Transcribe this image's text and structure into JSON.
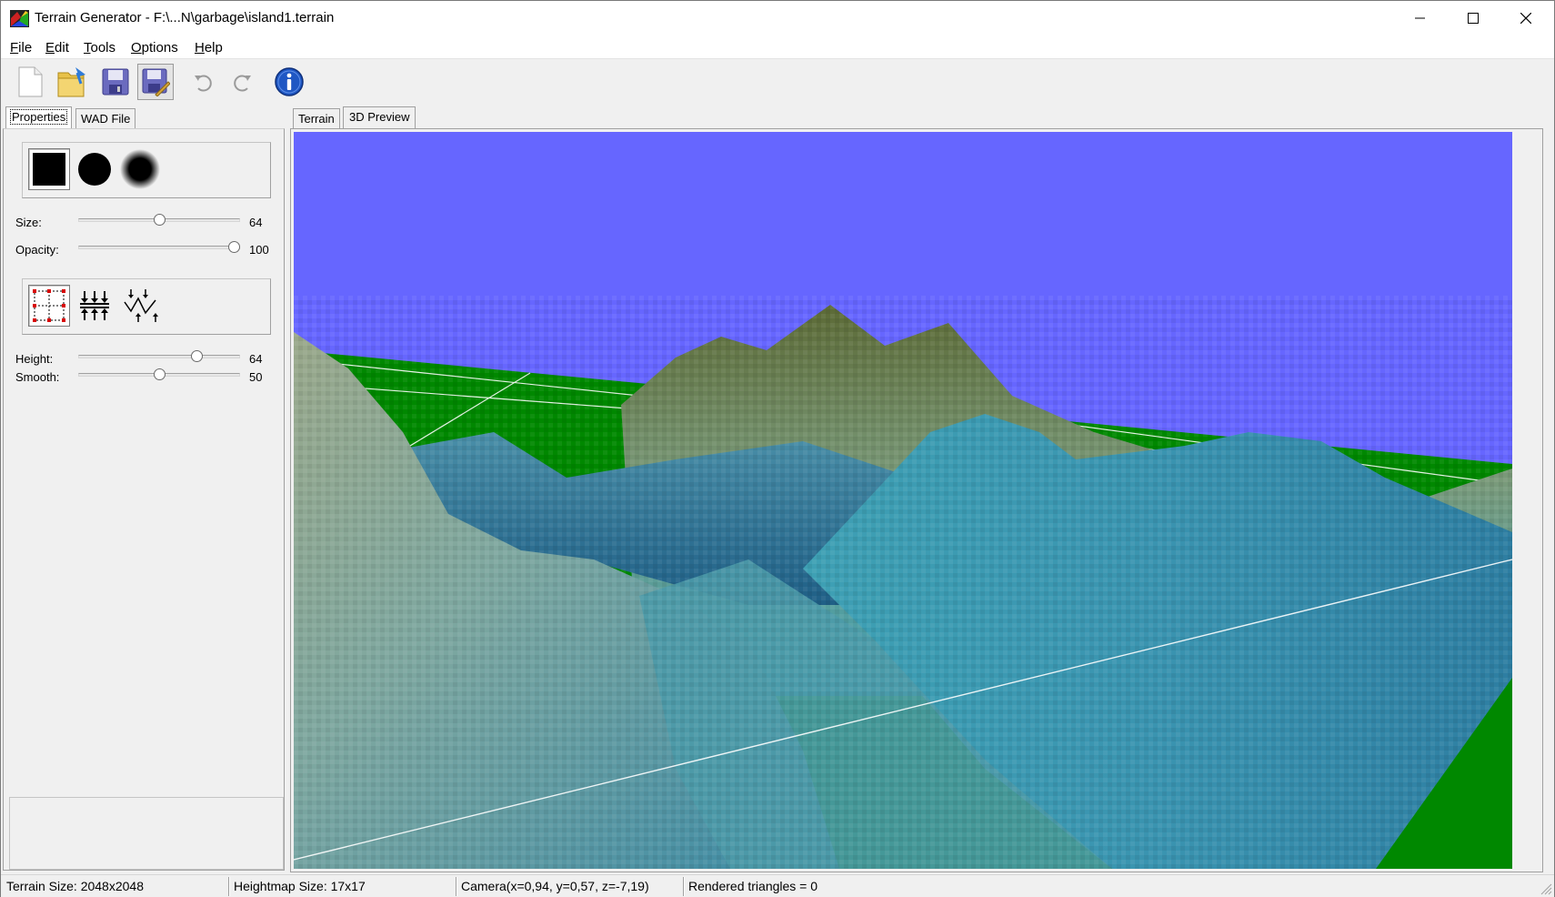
{
  "window": {
    "title": "Terrain Generator - F:\\...N\\garbage\\island1.terrain",
    "icons": {
      "app": "terrain-app-icon",
      "minimize": "minimize-icon",
      "maximize": "maximize-icon",
      "close": "close-icon"
    }
  },
  "menu": {
    "items": [
      {
        "key": "F",
        "rest": "ile"
      },
      {
        "key": "E",
        "rest": "dit"
      },
      {
        "key": "T",
        "rest": "ools"
      },
      {
        "key": "O",
        "rest": "ptions"
      },
      {
        "key": "H",
        "rest": "elp"
      }
    ]
  },
  "toolbar": {
    "buttons": [
      "new-file-icon",
      "open-folder-icon",
      "save-icon",
      "save-as-icon",
      "undo-icon",
      "redo-icon",
      "info-icon"
    ]
  },
  "left_tabs": [
    {
      "label": "Properties",
      "active": true
    },
    {
      "label": "WAD File",
      "active": false
    }
  ],
  "right_tabs": [
    {
      "label": "Terrain",
      "active": false
    },
    {
      "label": "3D Preview",
      "active": true
    }
  ],
  "brush": {
    "shapes": [
      "square-brush-icon",
      "circle-brush-icon",
      "soft-circle-brush-icon"
    ],
    "selected": 0,
    "size": {
      "label": "Size:",
      "value": "64",
      "fraction": 0.5
    },
    "opacity": {
      "label": "Opacity:",
      "value": "100",
      "fraction": 1.0
    }
  },
  "tools": {
    "modes": [
      "select-points-icon",
      "raise-lower-icon",
      "smooth-icon"
    ],
    "selected": 0,
    "height": {
      "label": "Height:",
      "value": "64",
      "fraction": 0.75
    },
    "smooth": {
      "label": "Smooth:",
      "value": "50",
      "fraction": 0.5
    }
  },
  "colors": {
    "sky": "#6666ff",
    "ground": "#008800",
    "water": "#3aa3b5",
    "peak": "#5a6a35"
  },
  "status": {
    "terrain_size": "Terrain Size: 2048x2048",
    "heightmap_size": "Heightmap Size: 17x17",
    "camera": "Camera(x=0,94, y=0,57, z=-7,19)",
    "triangles": "Rendered triangles = 0"
  }
}
